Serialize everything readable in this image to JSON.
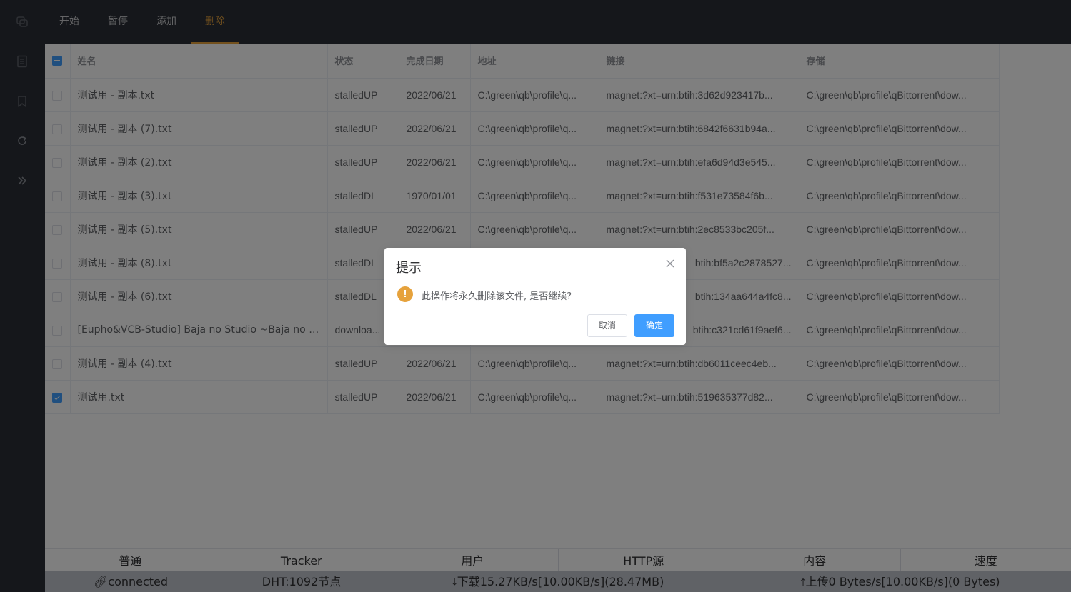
{
  "sidebar": {
    "icons": [
      "copy-icon",
      "document-icon",
      "bookmark-icon",
      "refresh-icon",
      "double-chevron-right-icon"
    ]
  },
  "tabs": [
    {
      "label": "开始"
    },
    {
      "label": "暂停"
    },
    {
      "label": "添加"
    },
    {
      "label": "删除",
      "active": true
    }
  ],
  "table": {
    "columns": [
      "姓名",
      "状态",
      "完成日期",
      "地址",
      "链接",
      "存储"
    ],
    "rows": [
      {
        "checked": false,
        "name": "测试用 - 副本.txt",
        "status": "stalledUP",
        "date": "2022/06/21",
        "addr": "C:\\green\\qb\\profile\\q...",
        "link": "magnet:?xt=urn:btih:3d62d923417b...",
        "store": "C:\\green\\qb\\profile\\qBittorrent\\dow..."
      },
      {
        "checked": false,
        "name": "测试用 - 副本 (7).txt",
        "status": "stalledUP",
        "date": "2022/06/21",
        "addr": "C:\\green\\qb\\profile\\q...",
        "link": "magnet:?xt=urn:btih:6842f6631b94a...",
        "store": "C:\\green\\qb\\profile\\qBittorrent\\dow..."
      },
      {
        "checked": false,
        "name": "测试用 - 副本 (2).txt",
        "status": "stalledUP",
        "date": "2022/06/21",
        "addr": "C:\\green\\qb\\profile\\q...",
        "link": "magnet:?xt=urn:btih:efa6d94d3e545...",
        "store": "C:\\green\\qb\\profile\\qBittorrent\\dow..."
      },
      {
        "checked": false,
        "name": "测试用 - 副本 (3).txt",
        "status": "stalledDL",
        "date": "1970/01/01",
        "addr": "C:\\green\\qb\\profile\\q...",
        "link": "magnet:?xt=urn:btih:f531e73584f6b...",
        "store": "C:\\green\\qb\\profile\\qBittorrent\\dow..."
      },
      {
        "checked": false,
        "name": "测试用 - 副本 (5).txt",
        "status": "stalledUP",
        "date": "2022/06/21",
        "addr": "C:\\green\\qb\\profile\\q...",
        "link": "magnet:?xt=urn:btih:2ec8533bc205f...",
        "store": "C:\\green\\qb\\profile\\qBittorrent\\dow..."
      },
      {
        "checked": false,
        "name": "测试用 - 副本 (8).txt",
        "status": "stalledDL",
        "date": "",
        "addr": "",
        "link": "btih:bf5a2c2878527...",
        "store": "C:\\green\\qb\\profile\\qBittorrent\\dow..."
      },
      {
        "checked": false,
        "name": "测试用 - 副本 (6).txt",
        "status": "stalledDL",
        "date": "",
        "addr": "",
        "link": "btih:134aa644a4fc8...",
        "store": "C:\\green\\qb\\profile\\qBittorrent\\dow..."
      },
      {
        "checked": false,
        "name": "[Eupho&VCB-Studio] Baja no Studio ~Baja no M...",
        "status": "downloa...",
        "date": "",
        "addr": "",
        "link": "btih:c321cd61f9aef6...",
        "store": "C:\\green\\qb\\profile\\qBittorrent\\dow..."
      },
      {
        "checked": false,
        "name": "测试用 - 副本 (4).txt",
        "status": "stalledUP",
        "date": "2022/06/21",
        "addr": "C:\\green\\qb\\profile\\q...",
        "link": "magnet:?xt=urn:btih:db6011ceec4eb...",
        "store": "C:\\green\\qb\\profile\\qBittorrent\\dow..."
      },
      {
        "checked": true,
        "name": "测试用.txt",
        "status": "stalledUP",
        "date": "2022/06/21",
        "addr": "C:\\green\\qb\\profile\\q...",
        "link": "magnet:?xt=urn:btih:519635377d82...",
        "store": "C:\\green\\qb\\profile\\qBittorrent\\dow..."
      }
    ]
  },
  "status_tabs": [
    "普通",
    "Tracker",
    "用户",
    "HTTP源",
    "内容",
    "速度"
  ],
  "status_bar": {
    "connection": "connected",
    "dht": "DHT:1092节点",
    "download": "下载15.27KB/s[10.00KB/s](28.47MB)",
    "upload": "上传0 Bytes/s[10.00KB/s](0 Bytes)"
  },
  "dialog": {
    "title": "提示",
    "message": "此操作将永久删除该文件, 是否继续?",
    "cancel_label": "取消",
    "ok_label": "确定",
    "warn_glyph": "!"
  },
  "colors": {
    "accent": "#e6a23c",
    "primary": "#409eff",
    "dark_bg": "#2b2f36"
  }
}
